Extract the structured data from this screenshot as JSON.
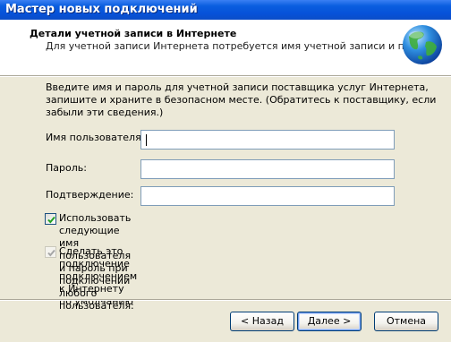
{
  "window": {
    "title": "Мастер новых подключений"
  },
  "header": {
    "title": "Детали учетной записи в Интернете",
    "subtitle": "Для учетной записи Интернета потребуется имя учетной записи и пароль.",
    "icon": "globe-icon"
  },
  "intro": {
    "text": "Введите имя и пароль для учетной записи поставщика услуг Интернета, запишите и храните в безопасном месте. (Обратитесь к поставщику, если забыли эти сведения.)"
  },
  "fields": {
    "username": {
      "label": "Имя пользователя:",
      "value": ""
    },
    "password": {
      "label": "Пароль:",
      "value": ""
    },
    "confirm": {
      "label": "Подтверждение:",
      "value": ""
    }
  },
  "checkboxes": {
    "use_for_all": {
      "line1": "Использовать следующие имя пользователя и пароль при подключении",
      "line2": "любого пользователя:",
      "checked": true
    },
    "default_connection": {
      "label": "Сделать это подключение подключением к Интернету по умолчанию",
      "checked": true,
      "disabled": true
    }
  },
  "buttons": {
    "back": "< Назад",
    "next": "Далее >",
    "cancel": "Отмена"
  },
  "colors": {
    "titlebar": "#0a5ee0",
    "dialog_bg": "#ece9d8",
    "check_mark": "#21a121"
  }
}
